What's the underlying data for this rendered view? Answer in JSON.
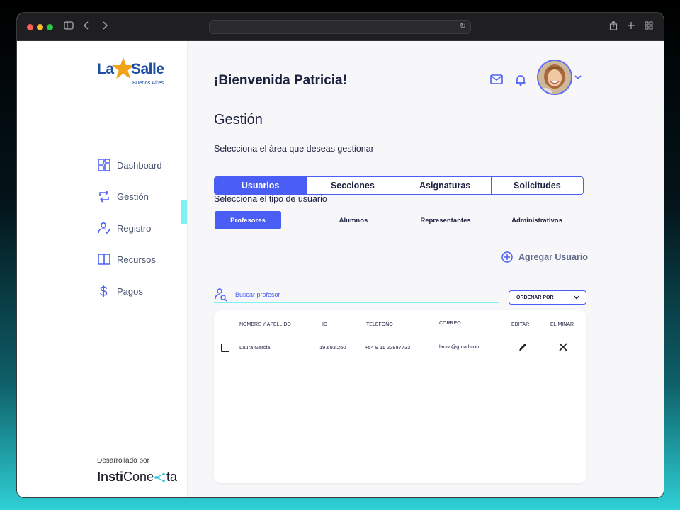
{
  "browser": {
    "url": ""
  },
  "sidebar": {
    "logo": {
      "la": "La",
      "salle": "Salle",
      "sub": "Buenos Aires"
    },
    "items": [
      {
        "label": "Dashboard",
        "icon": "dashboard-icon"
      },
      {
        "label": "Gestión",
        "icon": "refresh-icon",
        "active": true
      },
      {
        "label": "Registro",
        "icon": "user-check-icon"
      },
      {
        "label": "Recursos",
        "icon": "book-icon"
      },
      {
        "label": "Pagos",
        "icon": "dollar-icon"
      }
    ],
    "developed_by": "Desarrollado por",
    "brand": {
      "bold": "Insti",
      "regular": "Cone",
      "tail": "ta"
    }
  },
  "header": {
    "welcome": "¡Bienvenida Patricia!",
    "icons": [
      "mail-icon",
      "bell-icon",
      "avatar",
      "chevron-down-icon"
    ]
  },
  "main": {
    "title": "Gestión",
    "area_prompt": "Selecciona el área que deseas gestionar",
    "area_tabs": [
      {
        "label": "Usuarios",
        "active": true
      },
      {
        "label": "Secciones"
      },
      {
        "label": "Asignaturas"
      },
      {
        "label": "Solicitudes"
      }
    ],
    "type_prompt": "Selecciona el tipo de usuario",
    "user_types": [
      {
        "label": "Profesores",
        "active": true
      },
      {
        "label": "Alumnos"
      },
      {
        "label": "Representantes"
      },
      {
        "label": "Administrativos"
      }
    ],
    "add_user": "Agregar Usuario",
    "search": {
      "placeholder": "Buscar profesor",
      "value": ""
    },
    "order_by": "ORDENAR POR"
  },
  "table": {
    "columns": [
      "NOMBRE Y APELLIDO",
      "ID",
      "TELEFONO",
      "CORREO",
      "EDITAR",
      "ELIMINAR"
    ],
    "rows": [
      {
        "name": "Laura Garcia",
        "id": "19.693.260",
        "phone": "+54 9 11 22887733",
        "email": "laura@gmail.com"
      }
    ]
  },
  "colors": {
    "accent": "#4a5ef5",
    "cyan": "#7ff1f3",
    "text": "#1d2140"
  }
}
